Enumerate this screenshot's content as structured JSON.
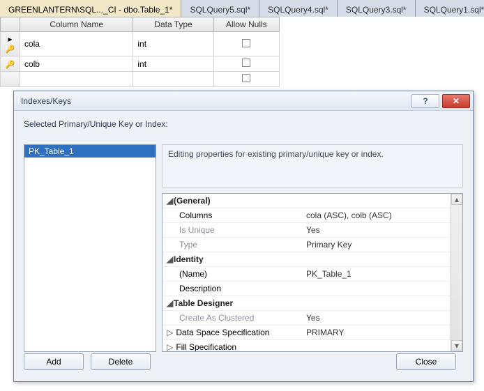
{
  "tabs": [
    {
      "label": "GREENLANTERN\\SQL..._CI - dbo.Table_1*",
      "active": true
    },
    {
      "label": "SQLQuery5.sql*",
      "active": false
    },
    {
      "label": "SQLQuery4.sql*",
      "active": false
    },
    {
      "label": "SQLQuery3.sql*",
      "active": false
    },
    {
      "label": "SQLQuery1.sql*",
      "active": false
    }
  ],
  "grid": {
    "headers": {
      "col_name": "Column Name",
      "data_type": "Data Type",
      "allow_nulls": "Allow Nulls"
    },
    "rows": [
      {
        "key": true,
        "arrow": true,
        "name": "cola",
        "type": "int",
        "allow_nulls": false
      },
      {
        "key": true,
        "arrow": false,
        "name": "colb",
        "type": "int",
        "allow_nulls": false
      },
      {
        "key": false,
        "arrow": false,
        "name": "",
        "type": "",
        "allow_nulls": false
      }
    ]
  },
  "dialog": {
    "title": "Indexes/Keys",
    "section_label": "Selected Primary/Unique Key or Index:",
    "list": [
      {
        "label": "PK_Table_1",
        "selected": true
      }
    ],
    "description": "Editing properties for existing primary/unique key or index.",
    "properties": {
      "general": {
        "header": "(General)",
        "columns": {
          "label": "Columns",
          "value": "cola (ASC), colb (ASC)"
        },
        "is_unique": {
          "label": "Is Unique",
          "value": "Yes"
        },
        "type": {
          "label": "Type",
          "value": "Primary Key"
        }
      },
      "identity": {
        "header": "Identity",
        "name": {
          "label": "(Name)",
          "value": "PK_Table_1"
        },
        "description": {
          "label": "Description",
          "value": ""
        }
      },
      "table_designer": {
        "header": "Table Designer",
        "create_as_clustered": {
          "label": "Create As Clustered",
          "value": "Yes"
        },
        "data_space_spec": {
          "label": "Data Space Specification",
          "value": "PRIMARY"
        },
        "fill_spec": {
          "label": "Fill Specification",
          "value": ""
        }
      }
    },
    "buttons": {
      "add": "Add",
      "delete": "Delete",
      "close": "Close"
    }
  }
}
